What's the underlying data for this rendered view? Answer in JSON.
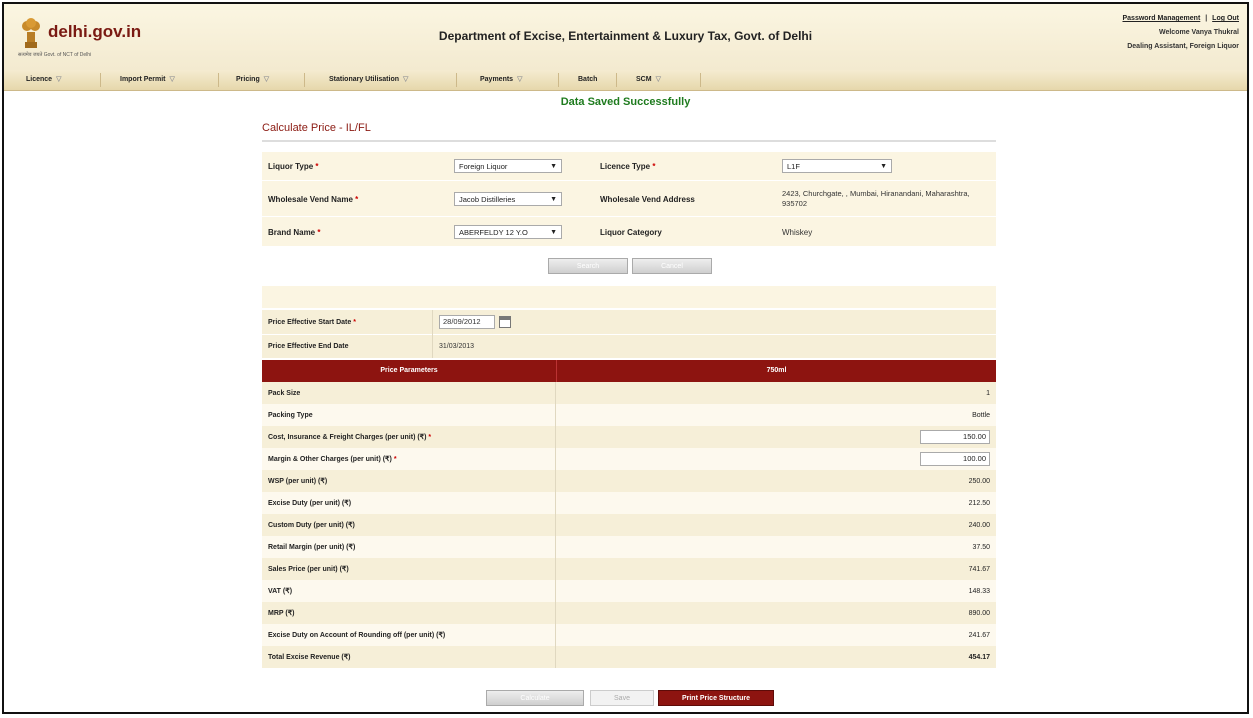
{
  "header": {
    "logo_text": "delhi.gov.in",
    "logo_sub": "सत्यमेव जयते   Govt. of NCT of Delhi",
    "title": "Department of Excise, Entertainment & Luxury Tax, Govt. of Delhi",
    "password_link": "Password Management",
    "logout_link": "Log Out",
    "separator": "|",
    "welcome": "Welcome Vanya Thukral",
    "role": "Dealing Assistant, Foreign Liquor"
  },
  "menu": [
    {
      "label": "Licence"
    },
    {
      "label": "Import Permit"
    },
    {
      "label": "Pricing"
    },
    {
      "label": "Stationary Utilisation"
    },
    {
      "label": "Payments"
    },
    {
      "label": "Batch"
    },
    {
      "label": "SCM"
    }
  ],
  "message": "Data Saved Successfully",
  "page_title": "Calculate Price - IL/FL",
  "form": {
    "liquor_type_label": "Liquor Type",
    "liquor_type_value": "Foreign Liquor",
    "licence_type_label": "Licence Type",
    "licence_type_value": "L1F",
    "vend_name_label": "Wholesale Vend Name",
    "vend_name_value": "Jacob Distilleries",
    "vend_address_label": "Wholesale Vend Address",
    "vend_address_value": "2423, Churchgate, , Mumbai, Hiranandani, Maharashtra, 935702",
    "brand_name_label": "Brand Name",
    "brand_name_value": "ABERFELDY 12 Y.O",
    "liquor_category_label": "Liquor Category",
    "liquor_category_value": "Whiskey",
    "required_mark": "*",
    "search_button": "Search",
    "cancel_button": "Cancel"
  },
  "dates": {
    "start_label": "Price Effective Start Date",
    "start_value": "28/09/2012",
    "end_label": "Price Effective End Date",
    "end_value": "31/03/2013"
  },
  "price_table": {
    "col1": "Price Parameters",
    "col2": "750ml",
    "rows": [
      {
        "label": "Pack Size",
        "value": "1"
      },
      {
        "label": "Packing Type",
        "value": "Bottle"
      },
      {
        "label": "Cost, Insurance & Freight Charges (per unit) (₹)",
        "value": "150.00",
        "required": "*"
      },
      {
        "label": "Margin & Other Charges (per unit) (₹)",
        "value": "100.00",
        "required": "*"
      },
      {
        "label": "WSP (per unit) (₹)",
        "value": "250.00"
      },
      {
        "label": "Excise Duty (per unit) (₹)",
        "value": "212.50"
      },
      {
        "label": "Custom Duty (per unit) (₹)",
        "value": "240.00"
      },
      {
        "label": "Retail Margin (per unit) (₹)",
        "value": "37.50"
      },
      {
        "label": "Sales Price (per unit) (₹)",
        "value": "741.67"
      },
      {
        "label": "VAT (₹)",
        "value": "148.33"
      },
      {
        "label": "MRP (₹)",
        "value": "890.00"
      },
      {
        "label": "Excise Duty on Account of Rounding off (per unit) (₹)",
        "value": "241.67"
      },
      {
        "label": "Total Excise Revenue (₹)",
        "value": "454.17"
      }
    ]
  },
  "footer_buttons": {
    "calculate": "Calculate",
    "save": "Save",
    "print": "Print Price Structure"
  }
}
